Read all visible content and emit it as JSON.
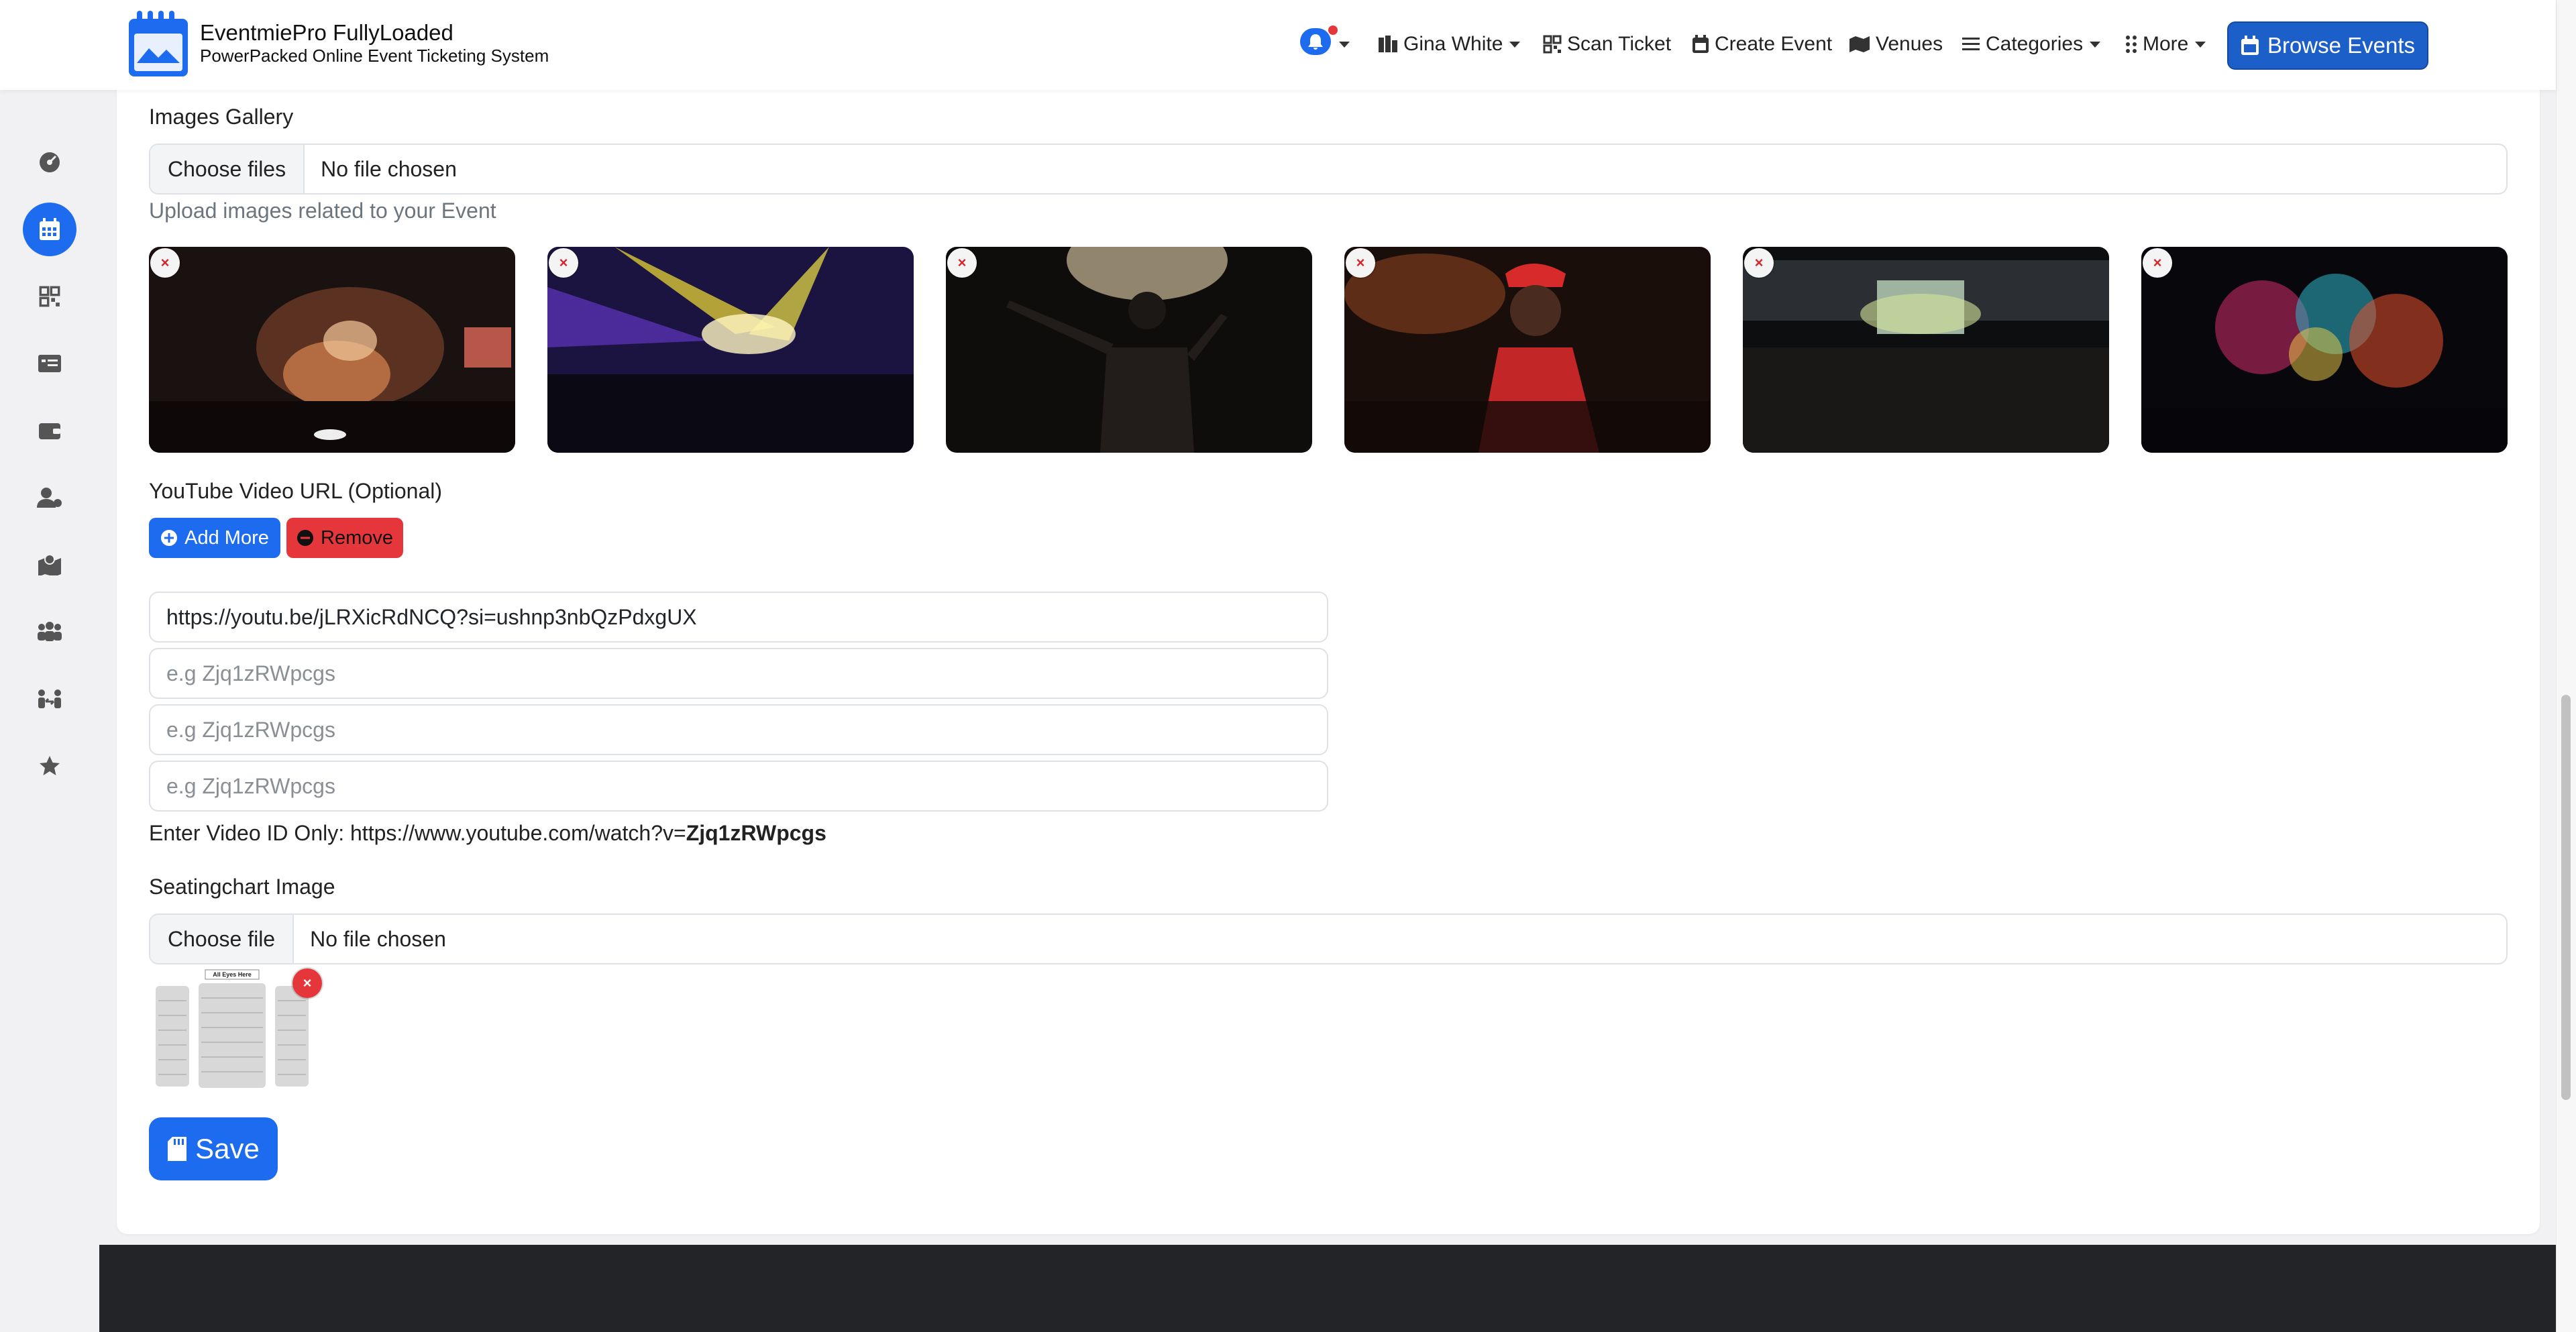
{
  "brand": {
    "title": "EventmiePro FullyLoaded",
    "subtitle": "PowerPacked Online Event Ticketing System"
  },
  "nav": {
    "user": "Gina White",
    "scan_ticket": "Scan Ticket",
    "create_event": "Create Event",
    "venues": "Venues",
    "categories": "Categories",
    "more": "More",
    "browse_events": "Browse Events"
  },
  "gallery": {
    "label": "Images Gallery",
    "choose_label": "Choose files",
    "status": "No file chosen",
    "help": "Upload images related to your Event",
    "remove_symbol": "×",
    "images": [
      {
        "name": "outdoor-stage-smoke"
      },
      {
        "name": "concert-yellow-lights"
      },
      {
        "name": "performer-on-stage"
      },
      {
        "name": "rapper-red-cap"
      },
      {
        "name": "stadium-crowd"
      },
      {
        "name": "fireworks"
      }
    ]
  },
  "youtube": {
    "label": "YouTube Video URL (Optional)",
    "add_more": "Add More",
    "remove": "Remove",
    "inputs": [
      {
        "value": "https://youtu.be/jLRXicRdNCQ?si=ushnp3nbQzPdxgUX"
      },
      {
        "placeholder": "e.g Zjq1zRWpcgs"
      },
      {
        "placeholder": "e.g Zjq1zRWpcgs"
      },
      {
        "placeholder": "e.g Zjq1zRWpcgs"
      }
    ],
    "hint_prefix": "Enter Video ID Only: https://www.youtube.com/watch?v=",
    "hint_id": "Zjq1zRWpcgs"
  },
  "seating": {
    "label": "Seatingchart Image",
    "choose_label": "Choose file",
    "status": "No file chosen",
    "thumb_caption": "All Eyes Here",
    "remove_symbol": "×"
  },
  "save": "Save",
  "colors": {
    "primary": "#1d6cf0",
    "danger": "#e5373b",
    "footer": "#232427"
  }
}
